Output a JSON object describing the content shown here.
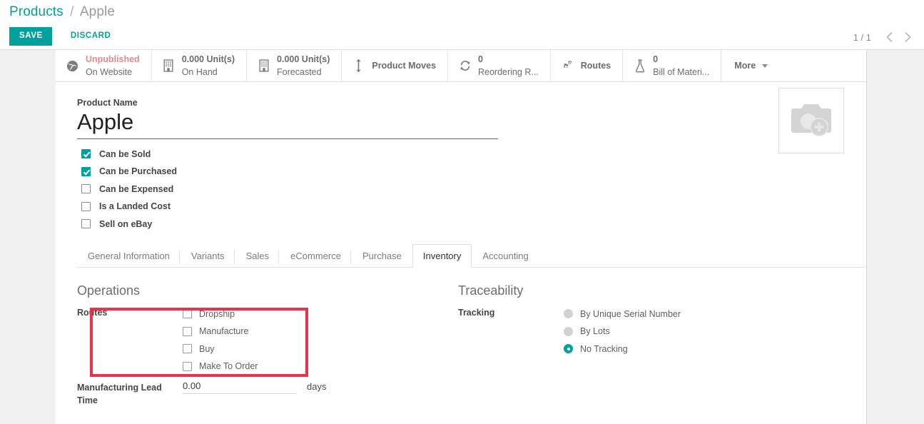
{
  "breadcrumb": {
    "root": "Products",
    "separator": "/",
    "current": "Apple"
  },
  "toolbar": {
    "save_label": "SAVE",
    "discard_label": "DISCARD"
  },
  "pager": {
    "count": "1 / 1",
    "prev_icon": "chevron-left-icon",
    "next_icon": "chevron-right-icon"
  },
  "stat_buttons": [
    {
      "icon": "globe-icon",
      "value": "Unpublished",
      "label": "On Website",
      "value_color": "#e08b8b"
    },
    {
      "icon": "building-icon",
      "value": "0.000 Unit(s)",
      "label": "On Hand"
    },
    {
      "icon": "building-icon",
      "value": "0.000 Unit(s)",
      "label": "Forecasted"
    },
    {
      "icon": "arrows-vertical-icon",
      "single": "Product Moves"
    },
    {
      "icon": "refresh-icon",
      "value": "0",
      "label": "Reordering R..."
    },
    {
      "icon": "gears-icon",
      "single": "Routes"
    },
    {
      "icon": "flask-icon",
      "value": "0",
      "label": "Bill of Materi..."
    }
  ],
  "more_button": {
    "label": "More",
    "icon": "caret-down-icon"
  },
  "product": {
    "name_field_label": "Product Name",
    "name_value": "Apple",
    "name_placeholder": "Product Name",
    "image_placeholder_icon": "camera-add-icon"
  },
  "product_flags": [
    {
      "label": "Can be Sold",
      "checked": true
    },
    {
      "label": "Can be Purchased",
      "checked": true
    },
    {
      "label": "Can be Expensed",
      "checked": false
    },
    {
      "label": "Is a Landed Cost",
      "checked": false
    },
    {
      "label": "Sell on eBay",
      "checked": false
    }
  ],
  "tabs": [
    {
      "label": "General Information",
      "active": false
    },
    {
      "label": "Variants",
      "active": false
    },
    {
      "label": "Sales",
      "active": false
    },
    {
      "label": "eCommerce",
      "active": false
    },
    {
      "label": "Purchase",
      "active": false
    },
    {
      "label": "Inventory",
      "active": true
    },
    {
      "label": "Accounting",
      "active": false
    }
  ],
  "inventory": {
    "operations": {
      "title": "Operations",
      "routes_label": "Routes",
      "routes": [
        {
          "label": "Dropship",
          "checked": false
        },
        {
          "label": "Manufacture",
          "checked": false
        },
        {
          "label": "Buy",
          "checked": false
        },
        {
          "label": "Make To Order",
          "checked": false
        }
      ],
      "lead_time_label": "Manufacturing Lead Time",
      "lead_time_value": "0.00",
      "lead_time_unit": "days"
    },
    "traceability": {
      "title": "Traceability",
      "tracking_label": "Tracking",
      "tracking_options": [
        {
          "label": "By Unique Serial Number",
          "selected": false
        },
        {
          "label": "By Lots",
          "selected": false
        },
        {
          "label": "No Tracking",
          "selected": true
        }
      ]
    }
  },
  "annotation": {
    "highlight_color": "#e8334a",
    "target": "routes-field"
  },
  "colors": {
    "accent": "#00a09d",
    "highlight": "#e8334a",
    "unpublished": "#e08b8b"
  }
}
